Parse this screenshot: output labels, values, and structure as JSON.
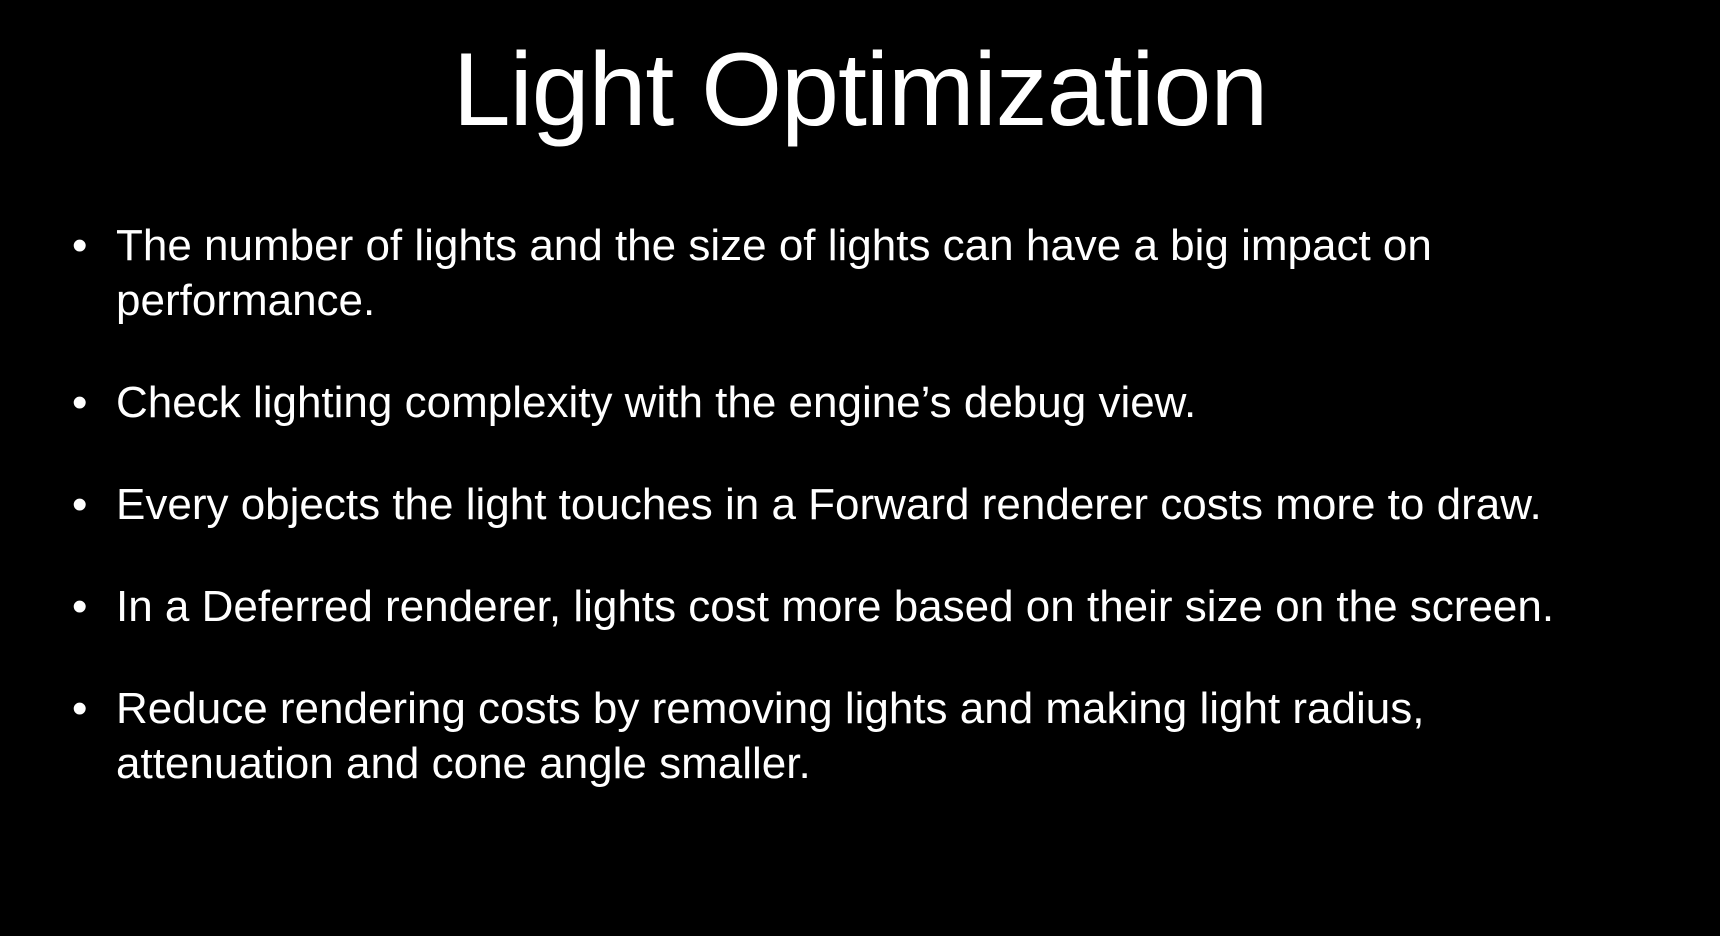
{
  "slide": {
    "title": "Light Optimization",
    "bullet_symbol": "•",
    "bullets": [
      {
        "text": "The number of lights and the size of lights can have a big impact on performance."
      },
      {
        "text": "Check lighting complexity with the engine’s debug view."
      },
      {
        "text": "Every objects the light touches in a Forward renderer costs more to draw."
      },
      {
        "text": "In a Deferred renderer, lights cost more based on their size on the screen."
      },
      {
        "text": "Reduce rendering costs by removing lights and making light radius, attenuation and cone angle smaller."
      }
    ]
  },
  "colors": {
    "background": "#000000",
    "text": "#ffffff"
  }
}
